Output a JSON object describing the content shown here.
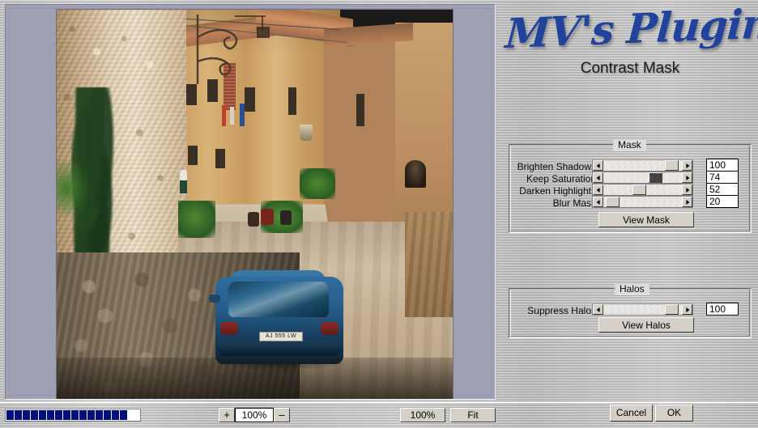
{
  "window": {
    "title": "Contrast Mask"
  },
  "branding": {
    "logo_script": "MV's Plugins",
    "plugin_name": "Contrast Mask",
    "logo_color": "#21439c"
  },
  "preview": {
    "photo_description": "Sunlit medieval Italian alley with stone walls, terracotta roofs and a blue hatchback car parked on the cobbled street",
    "license_plate": "AJ 555 LW",
    "background_color": "#a0a0b4"
  },
  "mask_panel": {
    "title": "Mask",
    "sliders": [
      {
        "label": "Brighten Shadows",
        "value": "100",
        "percent": 100,
        "focused": false
      },
      {
        "label": "Keep Saturation",
        "value": "74",
        "percent": 74,
        "focused": true
      },
      {
        "label": "Darken Highlights",
        "value": "52",
        "percent": 52,
        "focused": false
      },
      {
        "label": "Blur Mask",
        "value": "20",
        "percent": 4,
        "focused": false
      }
    ],
    "view_button": "View Mask"
  },
  "halos_panel": {
    "title": "Halos",
    "sliders": [
      {
        "label": "Suppress Halos",
        "value": "100",
        "percent": 100,
        "focused": false
      }
    ],
    "view_button": "View Halos"
  },
  "dialog_buttons": {
    "cancel": "Cancel",
    "ok": "OK"
  },
  "statusbar": {
    "progress_segments": 15,
    "progress_color": "#000f7d",
    "zoom_in": "+",
    "zoom_level": "100%",
    "zoom_out": "–",
    "zoom_100_label": "100%",
    "fit_label": "Fit"
  }
}
